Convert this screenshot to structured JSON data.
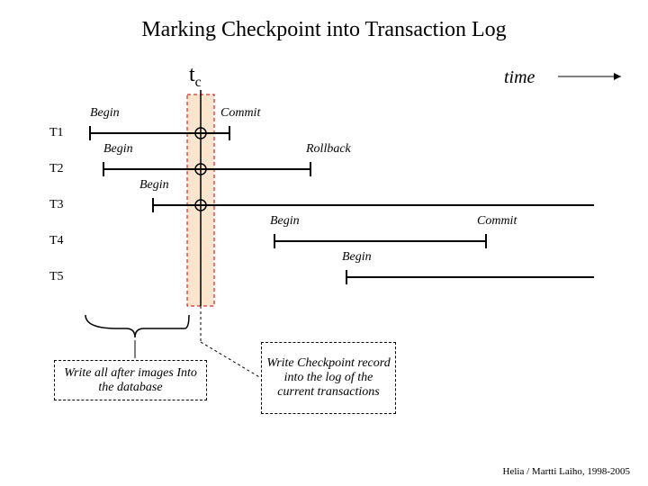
{
  "title": "Marking Checkpoint into Transaction Log",
  "tc": "t",
  "tc_sub": "c",
  "time": "time",
  "transactions": {
    "t1": "T1",
    "t2": "T2",
    "t3": "T3",
    "t4": "T4",
    "t5": "T5"
  },
  "events": {
    "begin": "Begin",
    "commit": "Commit",
    "rollback": "Rollback"
  },
  "box1": "Write all after images Into the database",
  "box2": "Write Checkpoint record into the log of the current transactions",
  "footer": "Helia / Martti Laiho, 1998-2005"
}
